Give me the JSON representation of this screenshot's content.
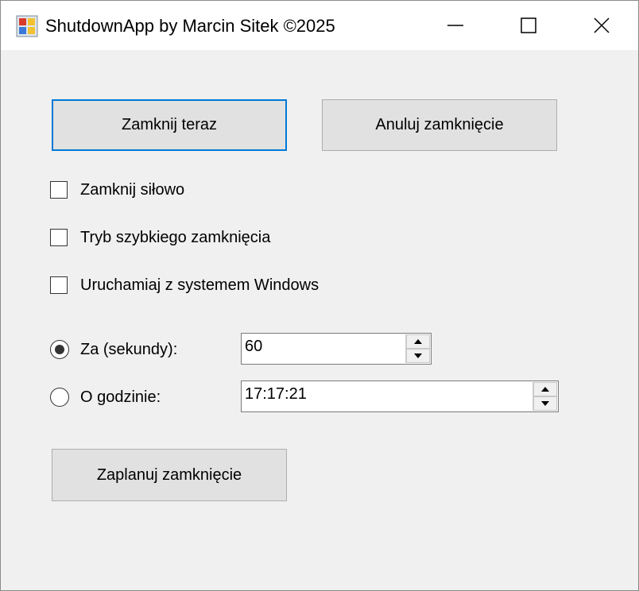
{
  "window": {
    "title": "ShutdownApp by Marcin Sitek ©2025"
  },
  "buttons": {
    "shutdown_now": "Zamknij teraz",
    "cancel_shutdown": "Anuluj zamknięcie",
    "schedule_shutdown": "Zaplanuj zamknięcie"
  },
  "checkboxes": [
    {
      "label": "Zamknij siłowo",
      "checked": false
    },
    {
      "label": "Tryb szybkiego zamknięcia",
      "checked": false
    },
    {
      "label": "Uruchamiaj z systemem Windows",
      "checked": false
    }
  ],
  "timer": {
    "seconds_label": "Za (sekundy):",
    "seconds_value": "60",
    "time_label": "O godzinie:",
    "time_value": "17:17:21",
    "selected": "seconds"
  },
  "colors": {
    "focus_border": "#0078d7",
    "button_bg": "#e1e1e1",
    "window_bg": "#f0f0f0"
  }
}
